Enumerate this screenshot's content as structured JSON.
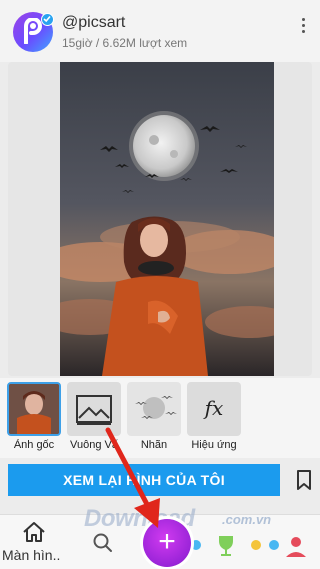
{
  "post": {
    "username": "@picsart",
    "meta": "15giờ / 6.62M lượt xem"
  },
  "effects": [
    {
      "label": "Ảnh gốc",
      "active": true
    },
    {
      "label": "Vuông Vấ",
      "active": false
    },
    {
      "label": "Nhãn",
      "active": false
    },
    {
      "label": "Hiệu ứng",
      "active": false
    }
  ],
  "cta": {
    "label": "XEM LẠI HÌNH CỦA TÔI"
  },
  "nav": {
    "home_label": "Màn hìn..",
    "create_symbol": "+"
  },
  "watermark": {
    "text": "Download",
    "suffix": ".com.vn"
  },
  "icons": [
    "picsart-logo-icon",
    "verified-icon",
    "more-vertical-icon",
    "bookmark-icon",
    "home-icon",
    "search-icon",
    "plus-icon",
    "arrow-icon"
  ],
  "colors": {
    "accent": "#1b9bee",
    "create": "#a42adf",
    "arrow": "#e0261b"
  }
}
